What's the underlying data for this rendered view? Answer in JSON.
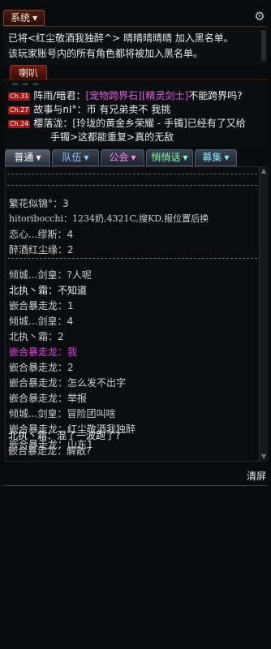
{
  "system": {
    "tab_label": "系统",
    "lines": [
      "已将<红尘敬酒我独醉^> 晴晴晴晴晴 加入黑名单。",
      "该玩家账号内的所有角色都将被加入黑名单。"
    ]
  },
  "horn": {
    "tab_label": "喇叭",
    "cut_line": "~ ~ ~",
    "rows": [
      {
        "badge": "Ch.31",
        "name": "阵雨/暗君",
        "sep": "：",
        "text_before": "",
        "link": "[宠物跨界石][精灵剑士]",
        "text_after": "不能跨界吗?"
      },
      {
        "badge": "Ch.27",
        "name": "故事与nI°",
        "sep": "：",
        "text_before": "币  有兄弟卖不 我挑",
        "link": "",
        "text_after": ""
      },
      {
        "badge": "Ch.24",
        "name": "樱落泷",
        "sep": "：",
        "text_before": "[玲珑的黄金乡荣耀 - 手镯]已经有了又给",
        "link": "",
        "text_after": ""
      }
    ],
    "wrap_line": "手镯>这都能重复>真的无敌"
  },
  "tabs": [
    {
      "label": "普通",
      "color": "#ffffff"
    },
    {
      "label": "队伍",
      "color": "#8ec8ff"
    },
    {
      "label": "公会",
      "color": "#ff8cf0"
    },
    {
      "label": "悄悄话",
      "color": "#8cffb0"
    },
    {
      "label": "募集",
      "color": "#8ce8ff"
    }
  ],
  "chat": {
    "block1": [
      "繁花似锦°：3",
      "hitoribocchi：1234奶,4321C,搜KD,报位置后换",
      "恋心...缪斯：4",
      "醉酒红尘缘：2"
    ],
    "block2": [
      {
        "name": "倾城...剑皇",
        "text": "：?人呢",
        "color": "#d0d0d0"
      },
      {
        "name": "北执丶霜",
        "text": "：不知道",
        "color": "#f0f0f0"
      },
      {
        "name": "嵌合暴走龙",
        "text": "：1",
        "color": "#d0d0d0"
      },
      {
        "name": "倾城...剑皇",
        "text": "：4",
        "color": "#d0d0d0"
      },
      {
        "name": "北执丶霜",
        "text": "：2",
        "color": "#d0d0d0"
      },
      {
        "name": "嵌合暴走龙",
        "text": "：我",
        "color": "#e040e0"
      },
      {
        "name": "嵌合暴走龙",
        "text": "：2",
        "color": "#d0d0d0"
      },
      {
        "name": "嵌合暴走龙",
        "text": "：怎么发不出字",
        "color": "#d0d0d0"
      },
      {
        "name": "嵌合暴走龙",
        "text": "：举报",
        "color": "#d0d0d0"
      },
      {
        "name": "倾城...剑皇",
        "text": "：冒险团叫啥",
        "color": "#d0d0d0"
      },
      {
        "name": "嵌合暴走龙",
        "text": "：红尘敬酒我独醉",
        "color": "#d0d0d0"
      },
      {
        "name": "嵌合暴走龙",
        "text": "：山东1",
        "color": "#d0d0d0"
      },
      {
        "name": "北执丶霜",
        "text": "：混了一波跑了?",
        "color": "#f0f0f0"
      },
      {
        "name": "嵌合暴走龙",
        "text": "：解散?",
        "color": "#d0d0d0"
      }
    ]
  },
  "clear_label": "清屏"
}
